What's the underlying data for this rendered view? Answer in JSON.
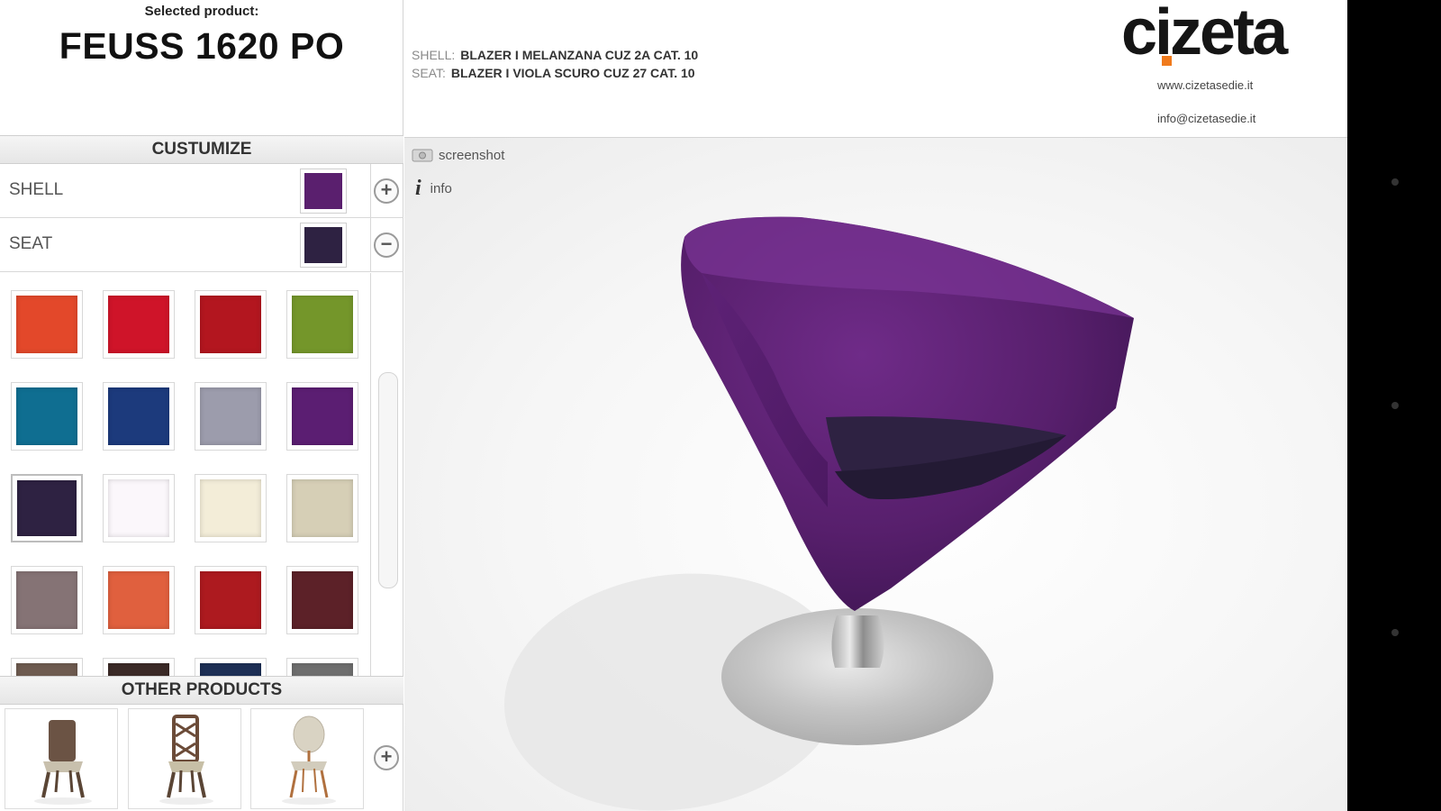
{
  "product": {
    "caption": "Selected product:",
    "name": "FEUSS 1620 PO"
  },
  "customize": {
    "title": "CUSTUMIZE",
    "options": [
      {
        "label": "SHELL",
        "color": "#5a1f6e",
        "action": "+"
      },
      {
        "label": "SEAT",
        "color": "#2e2242",
        "action": "−"
      }
    ],
    "palette": [
      {
        "color": "#e3482a"
      },
      {
        "color": "#cf1429"
      },
      {
        "color": "#b3161f"
      },
      {
        "color": "#74962a"
      },
      {
        "color": "#0f6e91"
      },
      {
        "color": "#1c3a7c"
      },
      {
        "color": "#9c9cac"
      },
      {
        "color": "#5b1e72"
      },
      {
        "color": "#2e2242",
        "selected": true
      },
      {
        "color": "#fbf7fb"
      },
      {
        "color": "#f3edd8"
      },
      {
        "color": "#d6cfb6"
      },
      {
        "color": "#857375"
      },
      {
        "color": "#e0603e"
      },
      {
        "color": "#ad1a1f"
      },
      {
        "color": "#5c2128"
      },
      {
        "color": "#6e5b50"
      },
      {
        "color": "#3b2a27"
      },
      {
        "color": "#1d2f55"
      },
      {
        "color": "#6e6e6e"
      }
    ]
  },
  "other_products": {
    "title": "OTHER PRODUCTS",
    "more_label": "+",
    "items": [
      {
        "name": "brown-chair"
      },
      {
        "name": "lattice-back-chair"
      },
      {
        "name": "oval-back-chair"
      }
    ]
  },
  "specs": {
    "shell_key": "SHELL:",
    "shell_value": "BLAZER I MELANZANA CUZ 2A CAT. 10",
    "seat_key": "SEAT:",
    "seat_value": "BLAZER I VIOLA SCURO CUZ 27 CAT. 10"
  },
  "brand": {
    "logo": "cizeta",
    "site": "www.cizetasedie.it",
    "email": "info@cizetasedie.it",
    "accent": "#f07a1c"
  },
  "viewer": {
    "screenshot_label": "screenshot",
    "info_icon": "i",
    "info_label": "info"
  }
}
